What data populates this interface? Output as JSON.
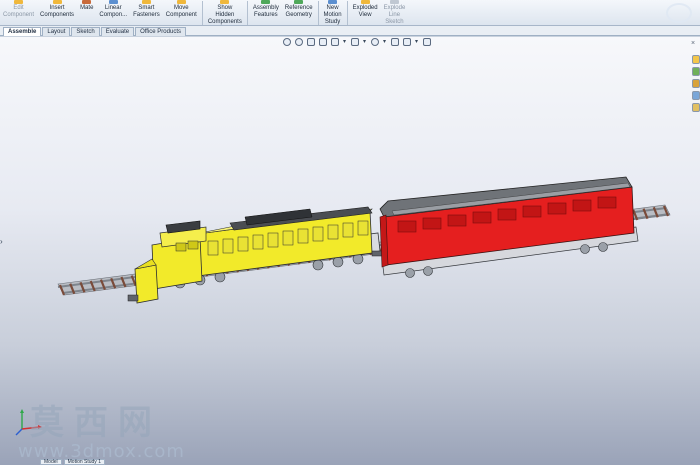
{
  "ribbon": {
    "buttons": [
      {
        "label": "Edit\nComponent",
        "disabled": true,
        "color": "#f0b83c"
      },
      {
        "label": "Insert\nComponents",
        "disabled": false,
        "color": "#f0b83c"
      },
      {
        "label": "Mate",
        "disabled": false,
        "color": "#c86a3a"
      },
      {
        "label": "Linear\nCompon...",
        "disabled": false,
        "color": "#5b8fd0"
      },
      {
        "label": "Smart\nFasteners",
        "disabled": false,
        "color": "#f0b83c"
      },
      {
        "label": "Move\nComponent",
        "disabled": false,
        "color": "#f0b83c"
      },
      {
        "label": "Show\nHidden\nComponents",
        "disabled": false,
        "color": "#f0b83c"
      },
      {
        "label": "Assembly\nFeatures",
        "disabled": false,
        "color": "#4fa85a"
      },
      {
        "label": "Reference\nGeometry",
        "disabled": false,
        "color": "#4fa85a"
      },
      {
        "label": "New\nMotion\nStudy",
        "disabled": false,
        "color": "#5b8fd0"
      },
      {
        "label": "Exploded\nView",
        "disabled": false,
        "color": "#f0b83c"
      },
      {
        "label": "Explode\nLine\nSketch",
        "disabled": true,
        "color": "#c0c8d2"
      }
    ]
  },
  "tabs": [
    {
      "label": "Assemble",
      "active": true
    },
    {
      "label": "Layout",
      "active": false
    },
    {
      "label": "Sketch",
      "active": false
    },
    {
      "label": "Evaluate",
      "active": false
    },
    {
      "label": "Office Products",
      "active": false
    }
  ],
  "viewport": {
    "heads_up_icons": [
      "zoom-to-fit-icon",
      "zoom-to-area-icon",
      "previous-view-icon",
      "section-view-icon",
      "view-orientation-icon",
      "display-style-icon",
      "hide-show-items-icon",
      "edit-appearance-icon",
      "apply-scene-icon",
      "view-settings-icon"
    ],
    "taskpane_colors": [
      "#f3c64a",
      "#6fb05a",
      "#d8a23a",
      "#7aa6d8",
      "#e1c063"
    ],
    "close_glyph": "×",
    "locomotive_color": "#f2ea2a",
    "coach_color": "#e51f1f",
    "coach_roof_color": "#6f7378",
    "rail_color": "#8a8f96",
    "sleeper_color": "#7a4b3a"
  },
  "watermark": {
    "chars": "莫西网",
    "url": "www.3dmox.com"
  },
  "model_tabs": [
    "Model",
    "Motion Study 1"
  ]
}
